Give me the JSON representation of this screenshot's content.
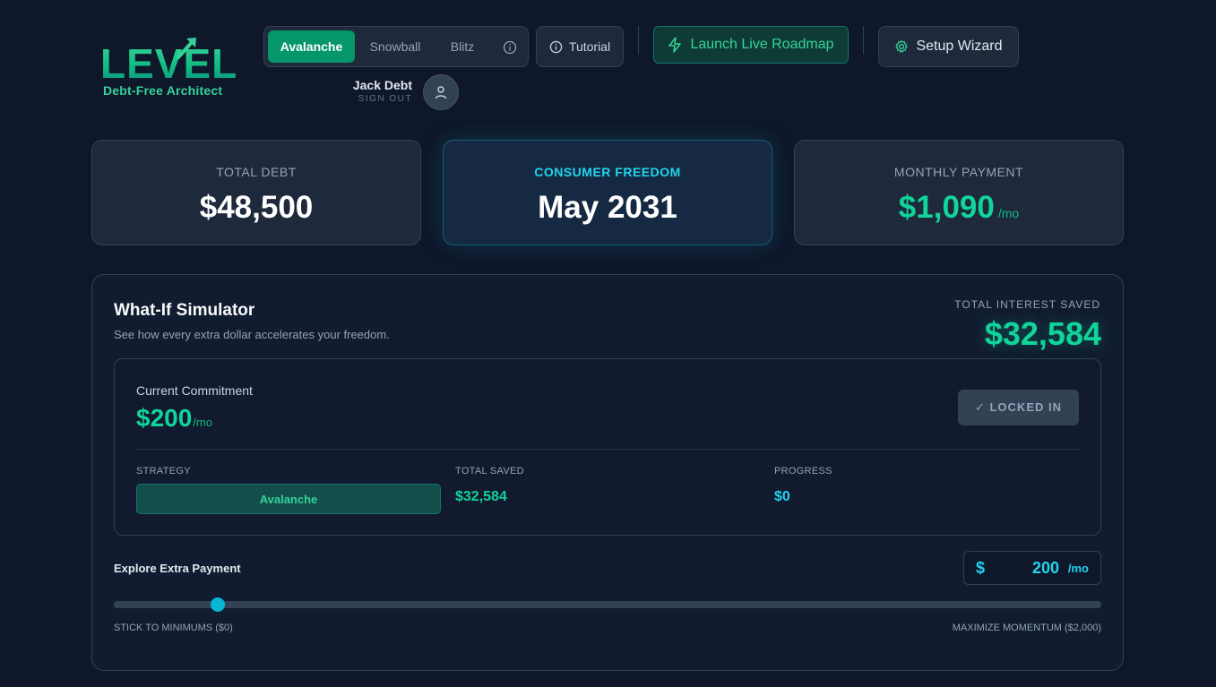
{
  "brand": {
    "name": "LEVEL",
    "tagline": "Debt-Free Architect",
    "accent": "#10b981"
  },
  "header": {
    "strategies": [
      {
        "label": "Avalanche",
        "active": true
      },
      {
        "label": "Snowball",
        "active": false
      },
      {
        "label": "Blitz",
        "active": false
      }
    ],
    "info_icon": "info-icon",
    "tutorial_label": "Tutorial",
    "roadmap_label": "Launch Live Roadmap",
    "wizard_label": "Setup Wizard",
    "user": {
      "name": "Jack Debt",
      "sign_out": "SIGN OUT"
    }
  },
  "stats": [
    {
      "label": "TOTAL DEBT",
      "value": "$48,500",
      "suffix": ""
    },
    {
      "label": "CONSUMER FREEDOM",
      "value": "May 2031",
      "suffix": ""
    },
    {
      "label": "MONTHLY PAYMENT",
      "value": "$1,090",
      "suffix": "/mo"
    }
  ],
  "simulator": {
    "title": "What-If Simulator",
    "subtitle": "See how every extra dollar accelerates your freedom.",
    "interest_saved_label": "TOTAL INTEREST SAVED",
    "interest_saved_value": "$32,584",
    "commitment": {
      "label": "Current Commitment",
      "value": "$200",
      "suffix": "/mo",
      "locked_label": "✓ LOCKED IN",
      "strategy_label": "STRATEGY",
      "strategy_value": "Avalanche",
      "total_saved_label": "TOTAL SAVED",
      "total_saved_value": "$32,584",
      "progress_label": "PROGRESS",
      "progress_value": "$0"
    },
    "explore": {
      "label": "Explore Extra Payment",
      "currency": "$",
      "amount": "200",
      "unit": "/mo",
      "min_label": "STICK TO MINIMUMS ($0)",
      "max_label": "MAXIMIZE MOMENTUM ($2,000)",
      "slider_min": 0,
      "slider_max": 2000,
      "slider_value": 210
    }
  }
}
